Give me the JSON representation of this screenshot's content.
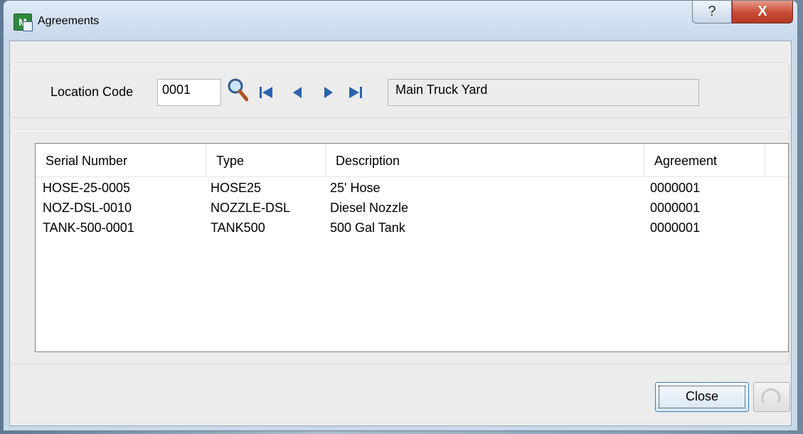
{
  "window": {
    "title": "Agreements",
    "help_glyph": "?",
    "close_glyph": "X"
  },
  "location": {
    "label": "Location Code",
    "code_value": "0001",
    "name_value": "Main Truck Yard",
    "icons": [
      "magnifier-lookup-icon",
      "first-record-icon",
      "previous-record-icon",
      "next-record-icon",
      "last-record-icon"
    ]
  },
  "table": {
    "columns": [
      "Serial Number",
      "Type",
      "Description",
      "Agreement"
    ],
    "rows": [
      [
        "HOSE-25-0005",
        "HOSE25",
        "25' Hose",
        "0000001"
      ],
      [
        "NOZ-DSL-0010",
        "NOZZLE-DSL",
        "Diesel Nozzle",
        "0000001"
      ],
      [
        "TANK-500-0001",
        "TANK500",
        "500 Gal Tank",
        "0000001"
      ]
    ]
  },
  "buttons": {
    "close_label": "Close"
  },
  "colors": {
    "titlebar": "#c6d8eb",
    "close_button": "#c94a32",
    "dialog_bg": "#ececec",
    "accent_border": "#3c7fb1"
  }
}
